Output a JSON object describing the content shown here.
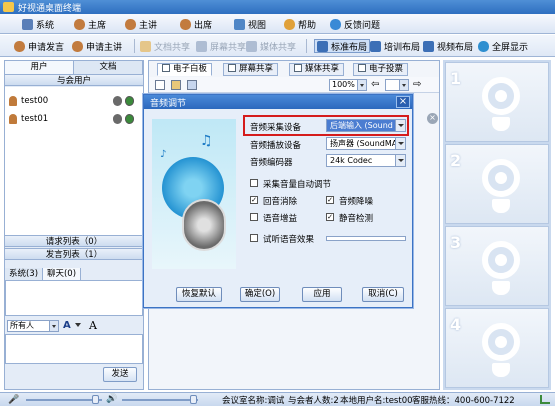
{
  "window": {
    "title": "好视通桌面终端"
  },
  "menubar": {
    "items": [
      "系统",
      "主席",
      "主讲",
      "出席",
      "视图",
      "帮助",
      "反馈问题"
    ]
  },
  "toolbar": {
    "items": [
      {
        "label": "申请发言",
        "disabled": false
      },
      {
        "label": "申请主讲",
        "disabled": false
      },
      {
        "label": "文档共享",
        "disabled": true
      },
      {
        "label": "屏幕共享",
        "disabled": true
      },
      {
        "label": "媒体共享",
        "disabled": true
      }
    ],
    "layouts": [
      "标准布局",
      "培训布局",
      "视频布局",
      "全屏显示"
    ]
  },
  "leftpanel": {
    "tabs": [
      "用户",
      "文档"
    ],
    "attendee_header": "与会用户",
    "users": [
      "test00",
      "test01"
    ],
    "request_list": "请求列表（0）",
    "speak_list": "发言列表（1）",
    "chat_tabs": [
      "系统(3)",
      "聊天(0)"
    ],
    "recipient": "所有人",
    "send_label": "发送"
  },
  "main": {
    "tabs": [
      "电子白板",
      "屏幕共享",
      "媒体共享",
      "电子投票"
    ],
    "zoom": "100%"
  },
  "video_slots": [
    "1",
    "2",
    "3",
    "4"
  ],
  "statusbar": {
    "meeting": "会议室名称:调试",
    "attendees": "与会者人数:2",
    "local_user": "本地用户名:test00",
    "hotline": "客服热线：400-600-7122"
  },
  "dialog": {
    "title": "音频调节",
    "fields": [
      {
        "label": "音频采集设备",
        "value": "后端输入 (Sound"
      },
      {
        "label": "音频播放设备",
        "value": "扬声器 (SoundMAX"
      },
      {
        "label": "音频编码器",
        "value": "24k Codec"
      }
    ],
    "checkboxes": [
      {
        "label": "采集音量自动调节",
        "checked": false
      },
      {
        "label": "回音消除",
        "checked": true
      },
      {
        "label": "音频降噪",
        "checked": true
      },
      {
        "label": "语音增益",
        "checked": false
      },
      {
        "label": "静音检测",
        "checked": true
      },
      {
        "label": "试听语音效果",
        "checked": false
      }
    ],
    "buttons": [
      "恢复默认",
      "确定(O)",
      "应用",
      "取消(C)"
    ]
  },
  "colors": {
    "accent": "#2e6fc0",
    "highlight_box": "#d51c1c"
  }
}
